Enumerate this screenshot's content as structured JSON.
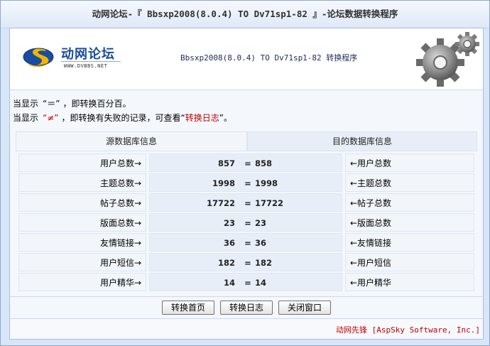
{
  "window": {
    "title": "动网论坛-『 Bbsxp2008(8.0.4) TO Dv71sp1-82 』-论坛数据转换程序"
  },
  "banner": {
    "logo_text": "动网论坛",
    "logo_url": "WWW.DVBBS.NET",
    "title": "Bbsxp2008(8.0.4) TO Dv71sp1-82 转换程序"
  },
  "notes": {
    "line1_prefix": "当显示",
    "line1_symbol": "“＝”",
    "line1_suffix": "，即转换百分百。",
    "line2_prefix": "当显示",
    "line2_symbol": "“≠”",
    "line2_middle": "，即转换有失败的记录，可查看“",
    "line2_link": "转换日志",
    "line2_end": "”。"
  },
  "headers": {
    "source": "源数据库信息",
    "target": "目的数据库信息"
  },
  "rows": [
    {
      "src_label": "用户总数→",
      "src": "857",
      "op": "=",
      "dst": "858",
      "dst_label": "←用户总数"
    },
    {
      "src_label": "主题总数→",
      "src": "1998",
      "op": "=",
      "dst": "1998",
      "dst_label": "←主题总数"
    },
    {
      "src_label": "帖子总数→",
      "src": "17722",
      "op": "=",
      "dst": "17722",
      "dst_label": "←帖子总数"
    },
    {
      "src_label": "版面总数→",
      "src": "23",
      "op": "=",
      "dst": "23",
      "dst_label": "←版面总数"
    },
    {
      "src_label": "友情链接→",
      "src": "36",
      "op": "=",
      "dst": "36",
      "dst_label": "←友情链接"
    },
    {
      "src_label": "用户短信→",
      "src": "182",
      "op": "=",
      "dst": "182",
      "dst_label": "←用户短信"
    },
    {
      "src_label": "用户精华→",
      "src": "14",
      "op": "=",
      "dst": "14",
      "dst_label": "←用户精华"
    }
  ],
  "buttons": {
    "home": "转换首页",
    "log": "转换日志",
    "close": "关闭窗口"
  },
  "footer": {
    "text": "动网先锋 [AspSky Software, Inc.]"
  },
  "colors": {
    "accent_red": "#c00000",
    "brand_blue": "#1a4da0",
    "logo_yellow": "#f2b400"
  },
  "icons": [
    "dvbbs-logo-icon",
    "gears-icon"
  ]
}
